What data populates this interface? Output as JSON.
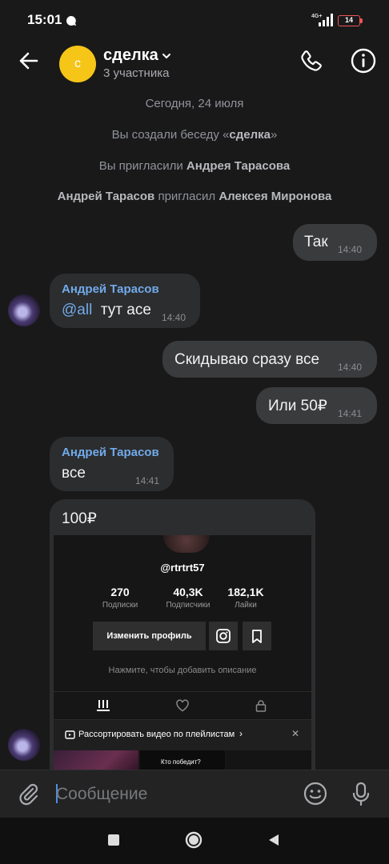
{
  "status_bar": {
    "time": "15:01",
    "network": "4G+",
    "battery": "14"
  },
  "header": {
    "avatar_letter": "с",
    "title": "сделка",
    "subtitle": "3 участника"
  },
  "service": {
    "date": "Сегодня, 24 июля",
    "created_prefix": "Вы создали беседу «",
    "created_name": "сделка",
    "created_suffix": "»",
    "invited_prefix": "Вы пригласили ",
    "invited_name": "Андрея Тарасова",
    "invite2_actor": "Андрей Тарасов",
    "invite2_mid": " пригласил ",
    "invite2_target": "Алексея Миронова"
  },
  "messages": [
    {
      "text": "Так",
      "time": "14:40"
    },
    {
      "sender": "Андрей Тарасов",
      "mention": "@all",
      "text": "тут асе",
      "time": "14:40"
    },
    {
      "text": "Скидываю сразу все",
      "time": "14:40"
    },
    {
      "text": "Или 50₽",
      "time": "14:41"
    },
    {
      "sender": "Андрей Тарасов",
      "text": "все",
      "time": "14:41"
    },
    {
      "text": "100₽"
    }
  ],
  "attachment": {
    "username": "@rtrtrt57",
    "stats": [
      {
        "value": "270",
        "label": "Подписки"
      },
      {
        "value": "40,3K",
        "label": "Подписчики"
      },
      {
        "value": "182,1K",
        "label": "Лайки"
      }
    ],
    "edit_button": "Изменить профиль",
    "bio_hint": "Нажмите, чтобы добавить описание",
    "playlist_banner": "Рассортировать видео по плейлистам",
    "thumb_caption": "Кто победит?"
  },
  "composer": {
    "placeholder": "Сообщение"
  },
  "colors": {
    "background": "#19191a",
    "bubble": "#2c2d2e",
    "accent": "#71aaeb",
    "group_avatar": "#f5c518"
  }
}
